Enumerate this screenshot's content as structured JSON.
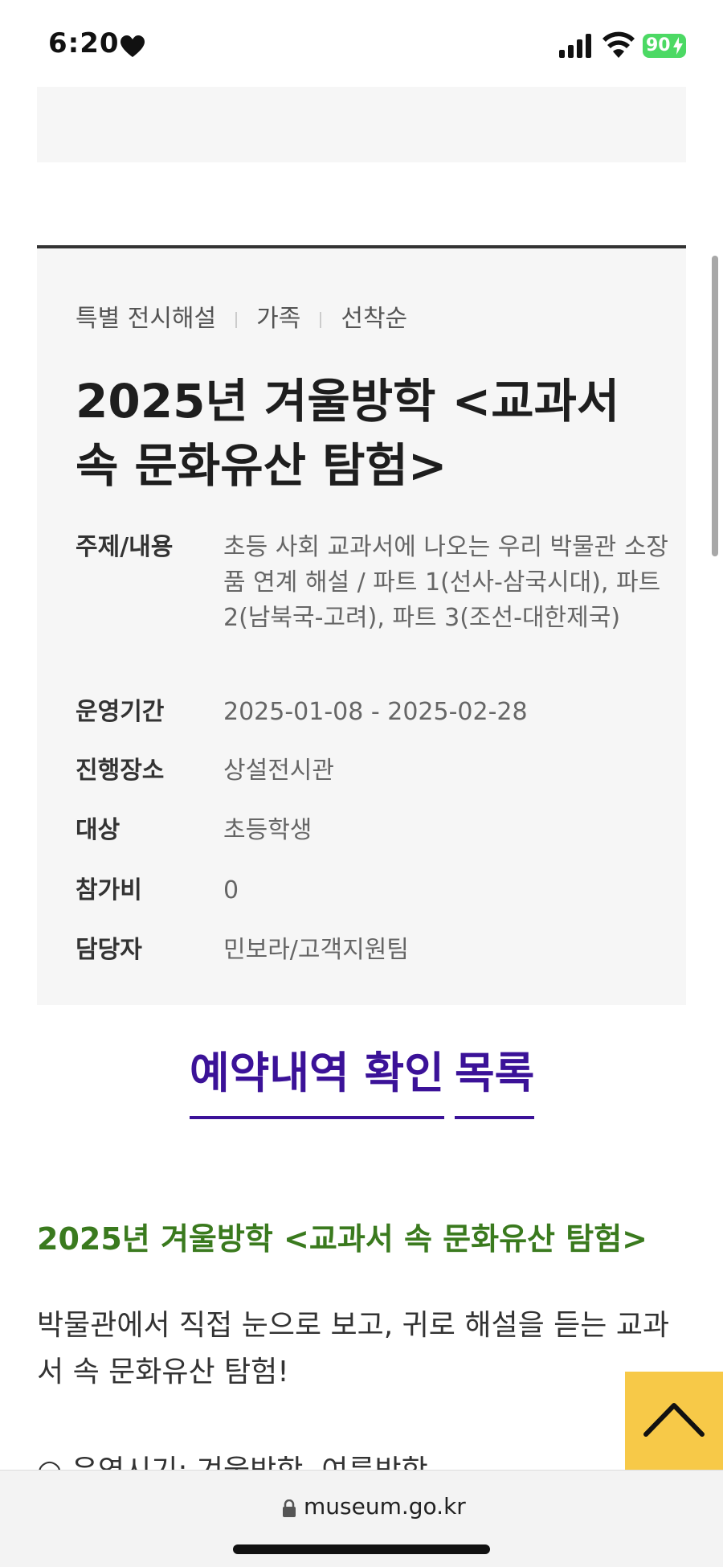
{
  "status_bar": {
    "time": "6:20",
    "battery": "90"
  },
  "info": {
    "tags": [
      "특별 전시해설",
      "가족",
      "선착순"
    ],
    "title": "2025년 겨울방학 <교과서 속 문화유산 탐험>",
    "fields": [
      {
        "label": "주제/내용",
        "value": "초등 사회 교과서에 나오는 우리 박물관 소장품 연계 해설 / 파트 1(선사-삼국시대), 파트 2(남북국-고려), 파트 3(조선-대한제국)"
      },
      {
        "label": "운영기간",
        "value": "2025-01-08 - 2025-02-28"
      },
      {
        "label": "진행장소",
        "value": "상설전시관"
      },
      {
        "label": "대상",
        "value": "초등학생"
      },
      {
        "label": "참가비",
        "value": "0"
      },
      {
        "label": "담당자",
        "value": "민보라/고객지원팀"
      }
    ]
  },
  "buttons": {
    "reservation": "예약내역 확인",
    "list": "목록"
  },
  "content": {
    "subtitle": "2025년 겨울방학 <교과서 속 문화유산 탐험>",
    "description": "박물관에서 직접 눈으로 보고, 귀로 해설을 듣는 교과서 속 문화유산 탐험!",
    "partial_line": "○ 운영시기: 겨울방학, 여름방학"
  },
  "browser": {
    "url": "museum.go.kr"
  },
  "colors": {
    "accent": "#3b1298",
    "subtitle_green": "#3a7a1e",
    "top_button": "#f7c948"
  }
}
